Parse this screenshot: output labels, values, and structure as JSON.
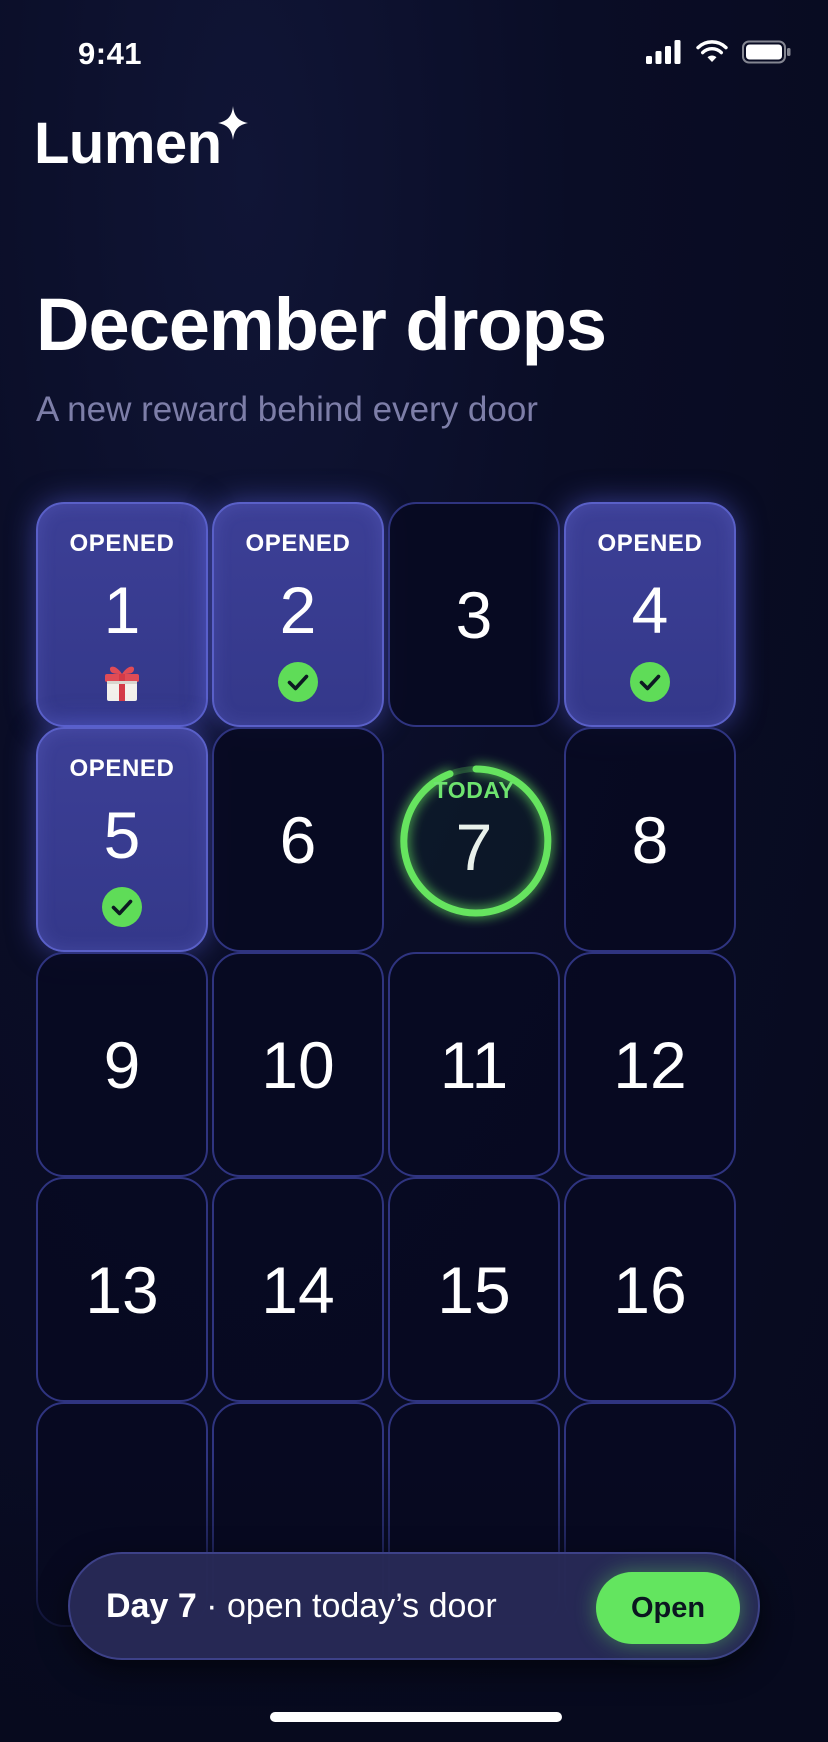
{
  "status_bar": {
    "time": "9:41",
    "icons": [
      "cellular-signal-icon",
      "wifi-icon",
      "battery-icon"
    ]
  },
  "brand": {
    "name": "Lumen",
    "icon": "sparkle-icon"
  },
  "header": {
    "title": "December drops",
    "subtitle": "A new reward behind every door"
  },
  "doors": [
    {
      "number": "1",
      "status": "OPENED",
      "state": "opened",
      "badge": "gift-icon"
    },
    {
      "number": "2",
      "status": "OPENED",
      "state": "opened",
      "badge": "check-icon"
    },
    {
      "number": "3",
      "status": "",
      "state": "locked",
      "badge": ""
    },
    {
      "number": "4",
      "status": "OPENED",
      "state": "opened",
      "badge": "check-icon"
    },
    {
      "number": "5",
      "status": "OPENED",
      "state": "opened",
      "badge": "check-icon"
    },
    {
      "number": "6",
      "status": "",
      "state": "locked",
      "badge": ""
    },
    {
      "number": "7",
      "status": "TODAY",
      "state": "today",
      "badge": ""
    },
    {
      "number": "8",
      "status": "",
      "state": "locked",
      "badge": ""
    },
    {
      "number": "9",
      "status": "",
      "state": "locked",
      "badge": ""
    },
    {
      "number": "10",
      "status": "",
      "state": "locked",
      "badge": ""
    },
    {
      "number": "11",
      "status": "",
      "state": "locked",
      "badge": ""
    },
    {
      "number": "12",
      "status": "",
      "state": "locked",
      "badge": ""
    },
    {
      "number": "13",
      "status": "",
      "state": "locked",
      "badge": ""
    },
    {
      "number": "14",
      "status": "",
      "state": "locked",
      "badge": ""
    },
    {
      "number": "15",
      "status": "",
      "state": "locked",
      "badge": ""
    },
    {
      "number": "16",
      "status": "",
      "state": "locked",
      "badge": ""
    },
    {
      "number": "",
      "status": "",
      "state": "locked",
      "badge": ""
    },
    {
      "number": "",
      "status": "",
      "state": "locked",
      "badge": ""
    },
    {
      "number": "",
      "status": "",
      "state": "locked",
      "badge": ""
    },
    {
      "number": "",
      "status": "",
      "state": "locked",
      "badge": ""
    }
  ],
  "cta": {
    "day": "Day 7",
    "text": " · open today’s door",
    "button_label": "Open"
  },
  "colors": {
    "background": "#070a1e",
    "opened_door": "#3a3d94",
    "door_border": "#2f3480",
    "accent_green": "#63e55f",
    "subtitle": "#7d7ea8"
  }
}
